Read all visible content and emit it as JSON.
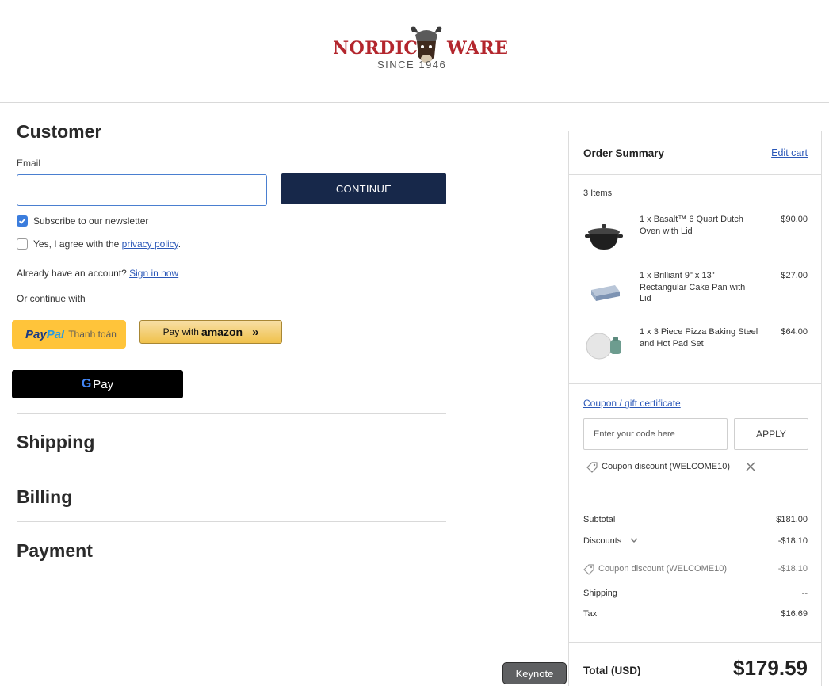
{
  "header": {
    "logo_left": "NORDIC",
    "logo_right": "WARE",
    "logo_since": "SINCE 1946"
  },
  "customer": {
    "title": "Customer",
    "email_label": "Email",
    "email_value": "",
    "continue_label": "CONTINUE",
    "newsletter_label": "Subscribe to our newsletter",
    "newsletter_checked": true,
    "privacy_prefix": "Yes, I agree with the ",
    "privacy_link": "privacy policy",
    "privacy_suffix": ".",
    "privacy_checked": false,
    "account_prompt": "Already have an account?",
    "sign_in_link": "Sign in now",
    "continue_with": "Or continue with",
    "paypal_brand_1": "Pay",
    "paypal_brand_2": "Pal",
    "paypal_sub": "Thanh toán",
    "amazon_prefix": "Pay with",
    "amazon_word": "amazon",
    "gpay_g": "G",
    "gpay_label": "Pay"
  },
  "sections": {
    "shipping": "Shipping",
    "billing": "Billing",
    "payment": "Payment"
  },
  "summary": {
    "title": "Order Summary",
    "edit_cart": "Edit cart",
    "items_count": "3 Items",
    "items": [
      {
        "name": "1 x Basalt™ 6 Quart Dutch Oven with Lid",
        "price": "$90.00",
        "icon": "dutch-oven"
      },
      {
        "name": "1 x Brilliant 9\" x 13\" Rectangular Cake Pan with Lid",
        "price": "$27.00",
        "icon": "cake-pan"
      },
      {
        "name": "1 x 3 Piece Pizza Baking Steel and Hot Pad Set",
        "price": "$64.00",
        "icon": "pizza-steel"
      }
    ],
    "coupon_link": "Coupon / gift certificate",
    "coupon_placeholder": "Enter your code here",
    "apply_label": "APPLY",
    "coupon_applied": "Coupon discount (WELCOME10)",
    "subtotal_label": "Subtotal",
    "subtotal_value": "$181.00",
    "discounts_label": "Discounts",
    "discounts_value": "-$18.10",
    "coupon_line_label": "Coupon discount (WELCOME10)",
    "coupon_line_value": "-$18.10",
    "shipping_label": "Shipping",
    "shipping_value": "--",
    "tax_label": "Tax",
    "tax_value": "$16.69",
    "total_label": "Total (USD)",
    "total_value": "$179.59"
  },
  "tooltip": {
    "label": "Keynote"
  },
  "colors": {
    "brand_red": "#b3262d",
    "continue_bg": "#17284a",
    "link": "#2b58b8",
    "checkbox": "#3b7ddd",
    "paypal_bg": "#ffc43a",
    "gpay_bg": "#000000"
  }
}
